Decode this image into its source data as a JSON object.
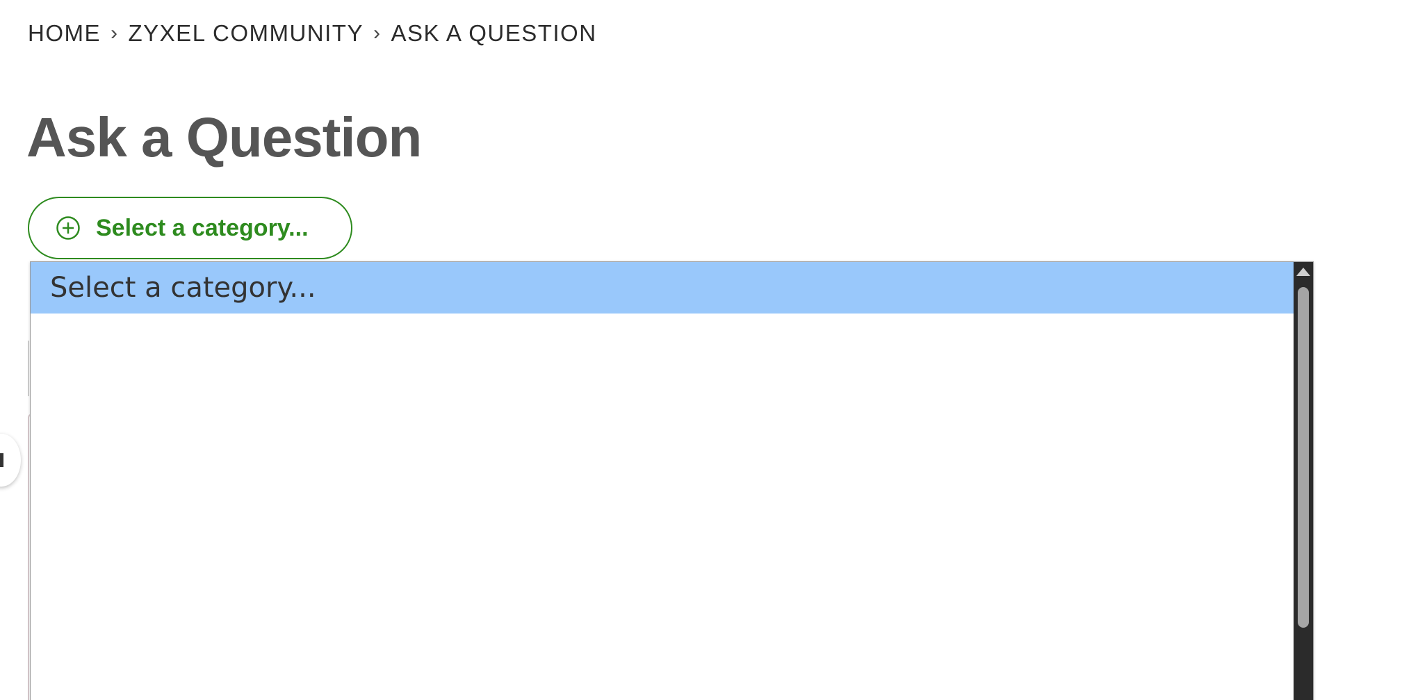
{
  "breadcrumb": {
    "items": [
      "HOME",
      "ZYXEL COMMUNITY",
      "ASK A QUESTION"
    ],
    "separator": "›"
  },
  "page": {
    "title": "Ask a Question"
  },
  "category_button": {
    "label": "Select a category...",
    "icon": "plus-circle-icon"
  },
  "category_dropdown": {
    "options": [
      "Select a category..."
    ],
    "selected": "Select a category..."
  },
  "colors": {
    "accent_green": "#2e8b1f",
    "title_gray": "#555555",
    "option_highlight": "#99c8fb"
  }
}
